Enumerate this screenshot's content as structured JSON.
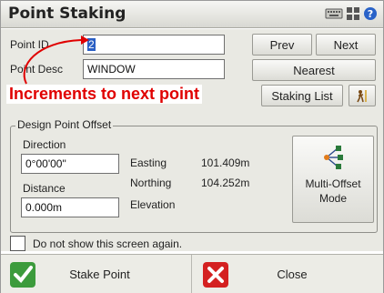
{
  "window": {
    "title": "Point Staking"
  },
  "form": {
    "point_id_label": "Point ID",
    "point_id_value": "2",
    "point_desc_label": "Point Desc",
    "point_desc_value": "WINDOW"
  },
  "buttons": {
    "prev": "Prev",
    "next": "Next",
    "nearest": "Nearest",
    "staking_list": "Staking List"
  },
  "annotation": "Increments to next point",
  "offset_group": {
    "legend": "Design Point Offset",
    "direction_label": "Direction",
    "direction_value": "0°00'00\"",
    "distance_label": "Distance",
    "distance_value": "0.000m",
    "easting_label": "Easting",
    "easting_value": "101.409m",
    "northing_label": "Northing",
    "northing_value": "104.252m",
    "elevation_label": "Elevation",
    "multi_offset_label": "Multi-Offset\nMode"
  },
  "checkbox": {
    "label": "Do not show this screen again.",
    "checked": false
  },
  "bottom": {
    "stake_point": "Stake Point",
    "close": "Close"
  },
  "colors": {
    "annotation": "#e00000",
    "ok_green": "#2e8b2e",
    "close_red": "#d42020"
  }
}
